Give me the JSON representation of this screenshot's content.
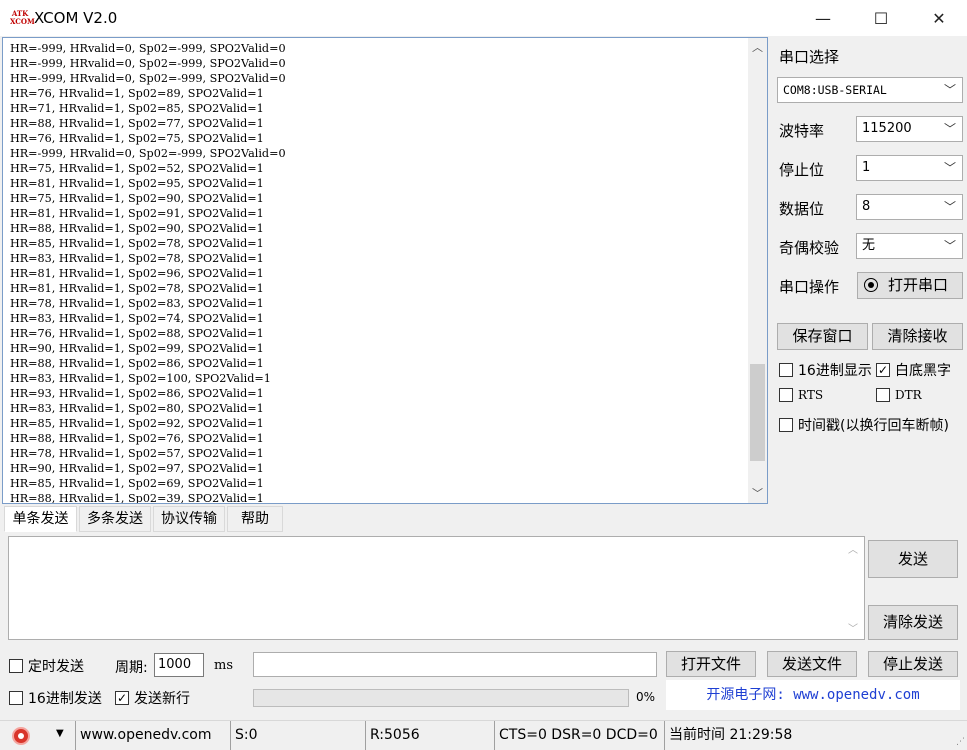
{
  "window": {
    "logo_text": "ATK XCOM",
    "title": "XCOM V2.0",
    "minimize": "—",
    "maximize": "☐",
    "close": "✕"
  },
  "receive": {
    "lines": [
      "HR=-999, HRvalid=0, Sp02=-999, SPO2Valid=0",
      "HR=-999, HRvalid=0, Sp02=-999, SPO2Valid=0",
      "HR=-999, HRvalid=0, Sp02=-999, SPO2Valid=0",
      "HR=76, HRvalid=1, Sp02=89, SPO2Valid=1",
      "HR=71, HRvalid=1, Sp02=85, SPO2Valid=1",
      "HR=88, HRvalid=1, Sp02=77, SPO2Valid=1",
      "HR=76, HRvalid=1, Sp02=75, SPO2Valid=1",
      "HR=-999, HRvalid=0, Sp02=-999, SPO2Valid=0",
      "HR=75, HRvalid=1, Sp02=52, SPO2Valid=1",
      "HR=81, HRvalid=1, Sp02=95, SPO2Valid=1",
      "HR=75, HRvalid=1, Sp02=90, SPO2Valid=1",
      "HR=81, HRvalid=1, Sp02=91, SPO2Valid=1",
      "HR=88, HRvalid=1, Sp02=90, SPO2Valid=1",
      "HR=85, HRvalid=1, Sp02=78, SPO2Valid=1",
      "HR=83, HRvalid=1, Sp02=78, SPO2Valid=1",
      "HR=81, HRvalid=1, Sp02=96, SPO2Valid=1",
      "HR=81, HRvalid=1, Sp02=78, SPO2Valid=1",
      "HR=78, HRvalid=1, Sp02=83, SPO2Valid=1",
      "HR=83, HRvalid=1, Sp02=74, SPO2Valid=1",
      "HR=76, HRvalid=1, Sp02=88, SPO2Valid=1",
      "HR=90, HRvalid=1, Sp02=99, SPO2Valid=1",
      "HR=88, HRvalid=1, Sp02=86, SPO2Valid=1",
      "HR=83, HRvalid=1, Sp02=100, SPO2Valid=1",
      "HR=93, HRvalid=1, Sp02=86, SPO2Valid=1",
      "HR=83, HRvalid=1, Sp02=80, SPO2Valid=1",
      "HR=85, HRvalid=1, Sp02=92, SPO2Valid=1",
      "HR=88, HRvalid=1, Sp02=76, SPO2Valid=1",
      "HR=78, HRvalid=1, Sp02=57, SPO2Valid=1",
      "HR=90, HRvalid=1, Sp02=97, SPO2Valid=1",
      "HR=85, HRvalid=1, Sp02=69, SPO2Valid=1",
      "HR=88, HRvalid=1, Sp02=39, SPO2Valid=1"
    ]
  },
  "settings": {
    "port_label": "串口选择",
    "port_value": "COM8:USB-SERIAL",
    "baud_label": "波特率",
    "baud_value": "115200",
    "stop_label": "停止位",
    "stop_value": "1",
    "data_label": "数据位",
    "data_value": "8",
    "parity_label": "奇偶校验",
    "parity_value": "无",
    "op_label": "串口操作",
    "open_port": "打开串口",
    "save_window": "保存窗口",
    "clear_receive": "清除接收",
    "hex_display": "16进制显示",
    "white_bg": "白底黑字",
    "rts": "RTS",
    "dtr": "DTR",
    "timestamp": "时间戳(以换行回车断帧)"
  },
  "tabs": [
    "单条发送",
    "多条发送",
    "协议传输",
    "帮助"
  ],
  "send": {
    "send_button": "发送",
    "clear_send": "清除发送",
    "timed_send": "定时发送",
    "period_label": "周期:",
    "period_value": "1000",
    "period_unit": "ms",
    "open_file": "打开文件",
    "send_file": "发送文件",
    "stop_send": "停止发送",
    "hex_send": "16进制发送",
    "send_newline": "发送新行",
    "progress_text": "0%",
    "progress_value": 0,
    "promo": "开源电子网: www.openedv.com"
  },
  "status": {
    "website": "www.openedv.com",
    "sent": "S:0",
    "received": "R:5056",
    "signals": "CTS=0 DSR=0 DCD=0",
    "time": "当前时间 21:29:58"
  }
}
